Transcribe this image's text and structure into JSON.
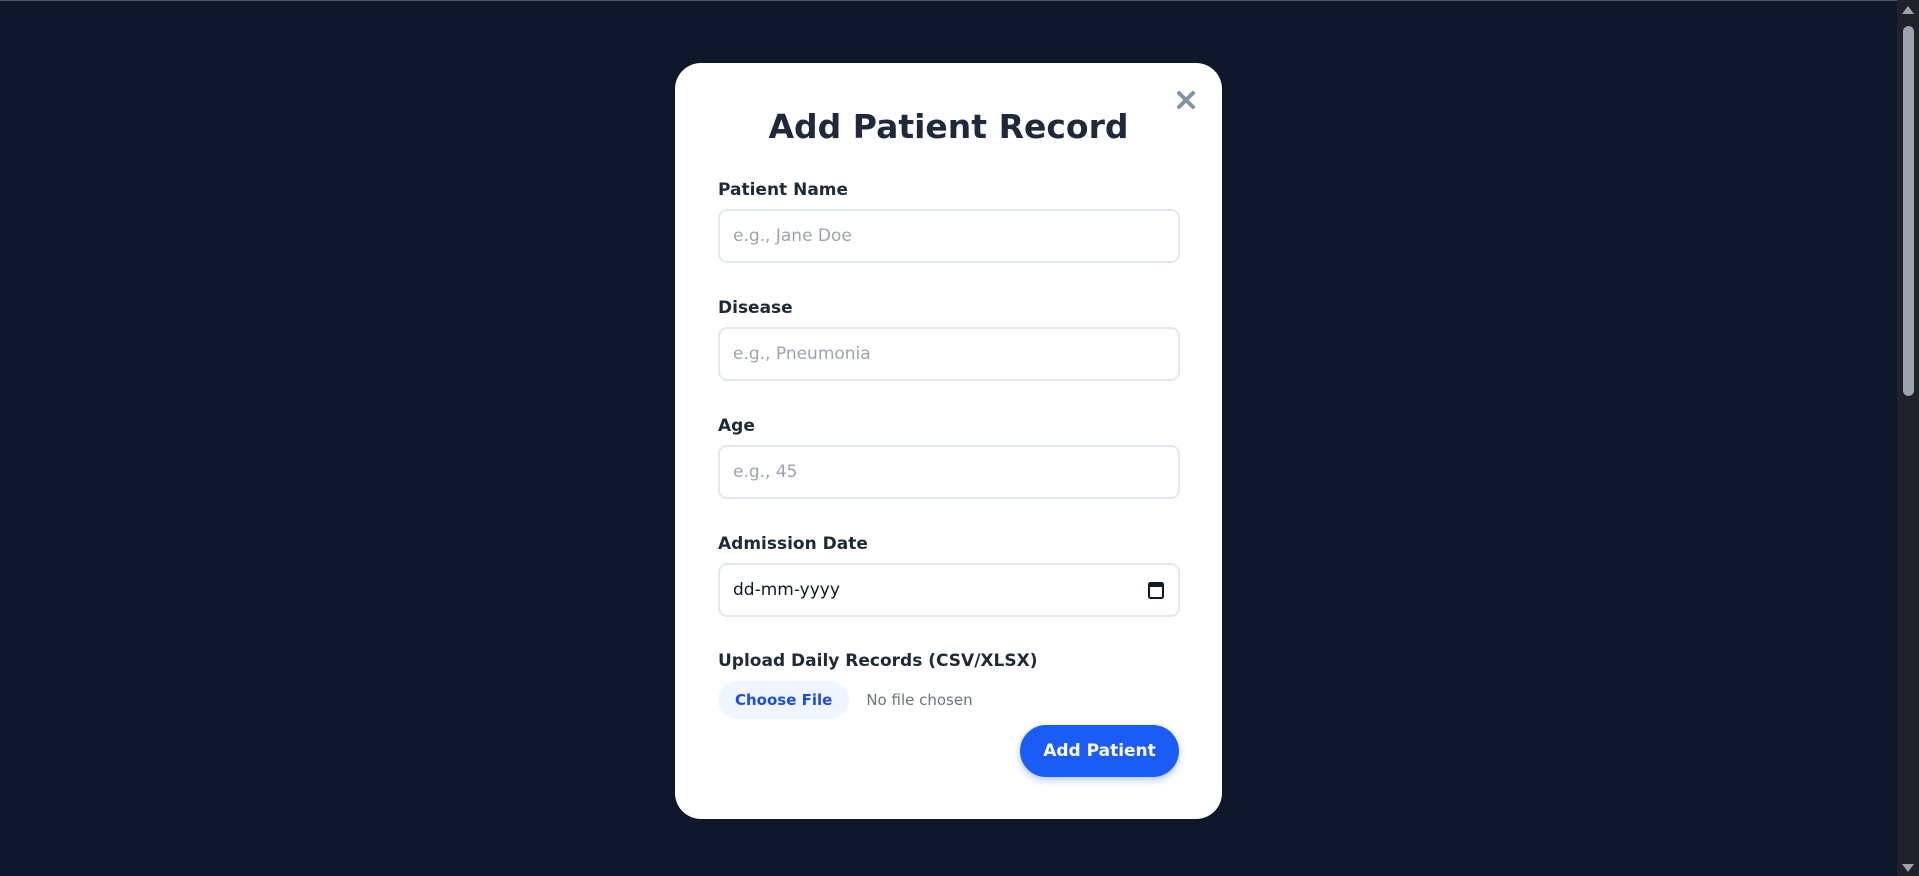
{
  "modal": {
    "title": "Add Patient Record",
    "close_icon": "close-icon",
    "fields": {
      "patient_name": {
        "label": "Patient Name",
        "placeholder": "e.g., Jane Doe",
        "value": ""
      },
      "disease": {
        "label": "Disease",
        "placeholder": "e.g., Pneumonia",
        "value": ""
      },
      "age": {
        "label": "Age",
        "placeholder": "e.g., 45",
        "value": ""
      },
      "admission_date": {
        "label": "Admission Date",
        "value": "dd-mm-yyyy",
        "icon": "calendar-icon"
      },
      "upload": {
        "label": "Upload Daily Records (CSV/XLSX)",
        "button_label": "Choose File",
        "status": "No file chosen"
      }
    },
    "submit_label": "Add Patient"
  },
  "colors": {
    "background": "#0f172a",
    "primary": "#1a5cf5",
    "title": "#1e293b"
  }
}
